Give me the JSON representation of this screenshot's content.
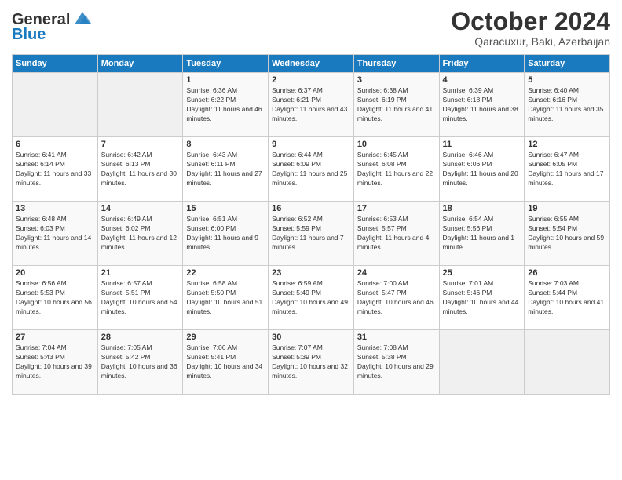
{
  "header": {
    "logo_line1": "General",
    "logo_line2": "Blue",
    "month": "October 2024",
    "location": "Qaracuxur, Baki, Azerbaijan"
  },
  "weekdays": [
    "Sunday",
    "Monday",
    "Tuesday",
    "Wednesday",
    "Thursday",
    "Friday",
    "Saturday"
  ],
  "weeks": [
    [
      {
        "day": "",
        "sunrise": "",
        "sunset": "",
        "daylight": ""
      },
      {
        "day": "",
        "sunrise": "",
        "sunset": "",
        "daylight": ""
      },
      {
        "day": "1",
        "sunrise": "Sunrise: 6:36 AM",
        "sunset": "Sunset: 6:22 PM",
        "daylight": "Daylight: 11 hours and 46 minutes."
      },
      {
        "day": "2",
        "sunrise": "Sunrise: 6:37 AM",
        "sunset": "Sunset: 6:21 PM",
        "daylight": "Daylight: 11 hours and 43 minutes."
      },
      {
        "day": "3",
        "sunrise": "Sunrise: 6:38 AM",
        "sunset": "Sunset: 6:19 PM",
        "daylight": "Daylight: 11 hours and 41 minutes."
      },
      {
        "day": "4",
        "sunrise": "Sunrise: 6:39 AM",
        "sunset": "Sunset: 6:18 PM",
        "daylight": "Daylight: 11 hours and 38 minutes."
      },
      {
        "day": "5",
        "sunrise": "Sunrise: 6:40 AM",
        "sunset": "Sunset: 6:16 PM",
        "daylight": "Daylight: 11 hours and 35 minutes."
      }
    ],
    [
      {
        "day": "6",
        "sunrise": "Sunrise: 6:41 AM",
        "sunset": "Sunset: 6:14 PM",
        "daylight": "Daylight: 11 hours and 33 minutes."
      },
      {
        "day": "7",
        "sunrise": "Sunrise: 6:42 AM",
        "sunset": "Sunset: 6:13 PM",
        "daylight": "Daylight: 11 hours and 30 minutes."
      },
      {
        "day": "8",
        "sunrise": "Sunrise: 6:43 AM",
        "sunset": "Sunset: 6:11 PM",
        "daylight": "Daylight: 11 hours and 27 minutes."
      },
      {
        "day": "9",
        "sunrise": "Sunrise: 6:44 AM",
        "sunset": "Sunset: 6:09 PM",
        "daylight": "Daylight: 11 hours and 25 minutes."
      },
      {
        "day": "10",
        "sunrise": "Sunrise: 6:45 AM",
        "sunset": "Sunset: 6:08 PM",
        "daylight": "Daylight: 11 hours and 22 minutes."
      },
      {
        "day": "11",
        "sunrise": "Sunrise: 6:46 AM",
        "sunset": "Sunset: 6:06 PM",
        "daylight": "Daylight: 11 hours and 20 minutes."
      },
      {
        "day": "12",
        "sunrise": "Sunrise: 6:47 AM",
        "sunset": "Sunset: 6:05 PM",
        "daylight": "Daylight: 11 hours and 17 minutes."
      }
    ],
    [
      {
        "day": "13",
        "sunrise": "Sunrise: 6:48 AM",
        "sunset": "Sunset: 6:03 PM",
        "daylight": "Daylight: 11 hours and 14 minutes."
      },
      {
        "day": "14",
        "sunrise": "Sunrise: 6:49 AM",
        "sunset": "Sunset: 6:02 PM",
        "daylight": "Daylight: 11 hours and 12 minutes."
      },
      {
        "day": "15",
        "sunrise": "Sunrise: 6:51 AM",
        "sunset": "Sunset: 6:00 PM",
        "daylight": "Daylight: 11 hours and 9 minutes."
      },
      {
        "day": "16",
        "sunrise": "Sunrise: 6:52 AM",
        "sunset": "Sunset: 5:59 PM",
        "daylight": "Daylight: 11 hours and 7 minutes."
      },
      {
        "day": "17",
        "sunrise": "Sunrise: 6:53 AM",
        "sunset": "Sunset: 5:57 PM",
        "daylight": "Daylight: 11 hours and 4 minutes."
      },
      {
        "day": "18",
        "sunrise": "Sunrise: 6:54 AM",
        "sunset": "Sunset: 5:56 PM",
        "daylight": "Daylight: 11 hours and 1 minute."
      },
      {
        "day": "19",
        "sunrise": "Sunrise: 6:55 AM",
        "sunset": "Sunset: 5:54 PM",
        "daylight": "Daylight: 10 hours and 59 minutes."
      }
    ],
    [
      {
        "day": "20",
        "sunrise": "Sunrise: 6:56 AM",
        "sunset": "Sunset: 5:53 PM",
        "daylight": "Daylight: 10 hours and 56 minutes."
      },
      {
        "day": "21",
        "sunrise": "Sunrise: 6:57 AM",
        "sunset": "Sunset: 5:51 PM",
        "daylight": "Daylight: 10 hours and 54 minutes."
      },
      {
        "day": "22",
        "sunrise": "Sunrise: 6:58 AM",
        "sunset": "Sunset: 5:50 PM",
        "daylight": "Daylight: 10 hours and 51 minutes."
      },
      {
        "day": "23",
        "sunrise": "Sunrise: 6:59 AM",
        "sunset": "Sunset: 5:49 PM",
        "daylight": "Daylight: 10 hours and 49 minutes."
      },
      {
        "day": "24",
        "sunrise": "Sunrise: 7:00 AM",
        "sunset": "Sunset: 5:47 PM",
        "daylight": "Daylight: 10 hours and 46 minutes."
      },
      {
        "day": "25",
        "sunrise": "Sunrise: 7:01 AM",
        "sunset": "Sunset: 5:46 PM",
        "daylight": "Daylight: 10 hours and 44 minutes."
      },
      {
        "day": "26",
        "sunrise": "Sunrise: 7:03 AM",
        "sunset": "Sunset: 5:44 PM",
        "daylight": "Daylight: 10 hours and 41 minutes."
      }
    ],
    [
      {
        "day": "27",
        "sunrise": "Sunrise: 7:04 AM",
        "sunset": "Sunset: 5:43 PM",
        "daylight": "Daylight: 10 hours and 39 minutes."
      },
      {
        "day": "28",
        "sunrise": "Sunrise: 7:05 AM",
        "sunset": "Sunset: 5:42 PM",
        "daylight": "Daylight: 10 hours and 36 minutes."
      },
      {
        "day": "29",
        "sunrise": "Sunrise: 7:06 AM",
        "sunset": "Sunset: 5:41 PM",
        "daylight": "Daylight: 10 hours and 34 minutes."
      },
      {
        "day": "30",
        "sunrise": "Sunrise: 7:07 AM",
        "sunset": "Sunset: 5:39 PM",
        "daylight": "Daylight: 10 hours and 32 minutes."
      },
      {
        "day": "31",
        "sunrise": "Sunrise: 7:08 AM",
        "sunset": "Sunset: 5:38 PM",
        "daylight": "Daylight: 10 hours and 29 minutes."
      },
      {
        "day": "",
        "sunrise": "",
        "sunset": "",
        "daylight": ""
      },
      {
        "day": "",
        "sunrise": "",
        "sunset": "",
        "daylight": ""
      }
    ]
  ]
}
